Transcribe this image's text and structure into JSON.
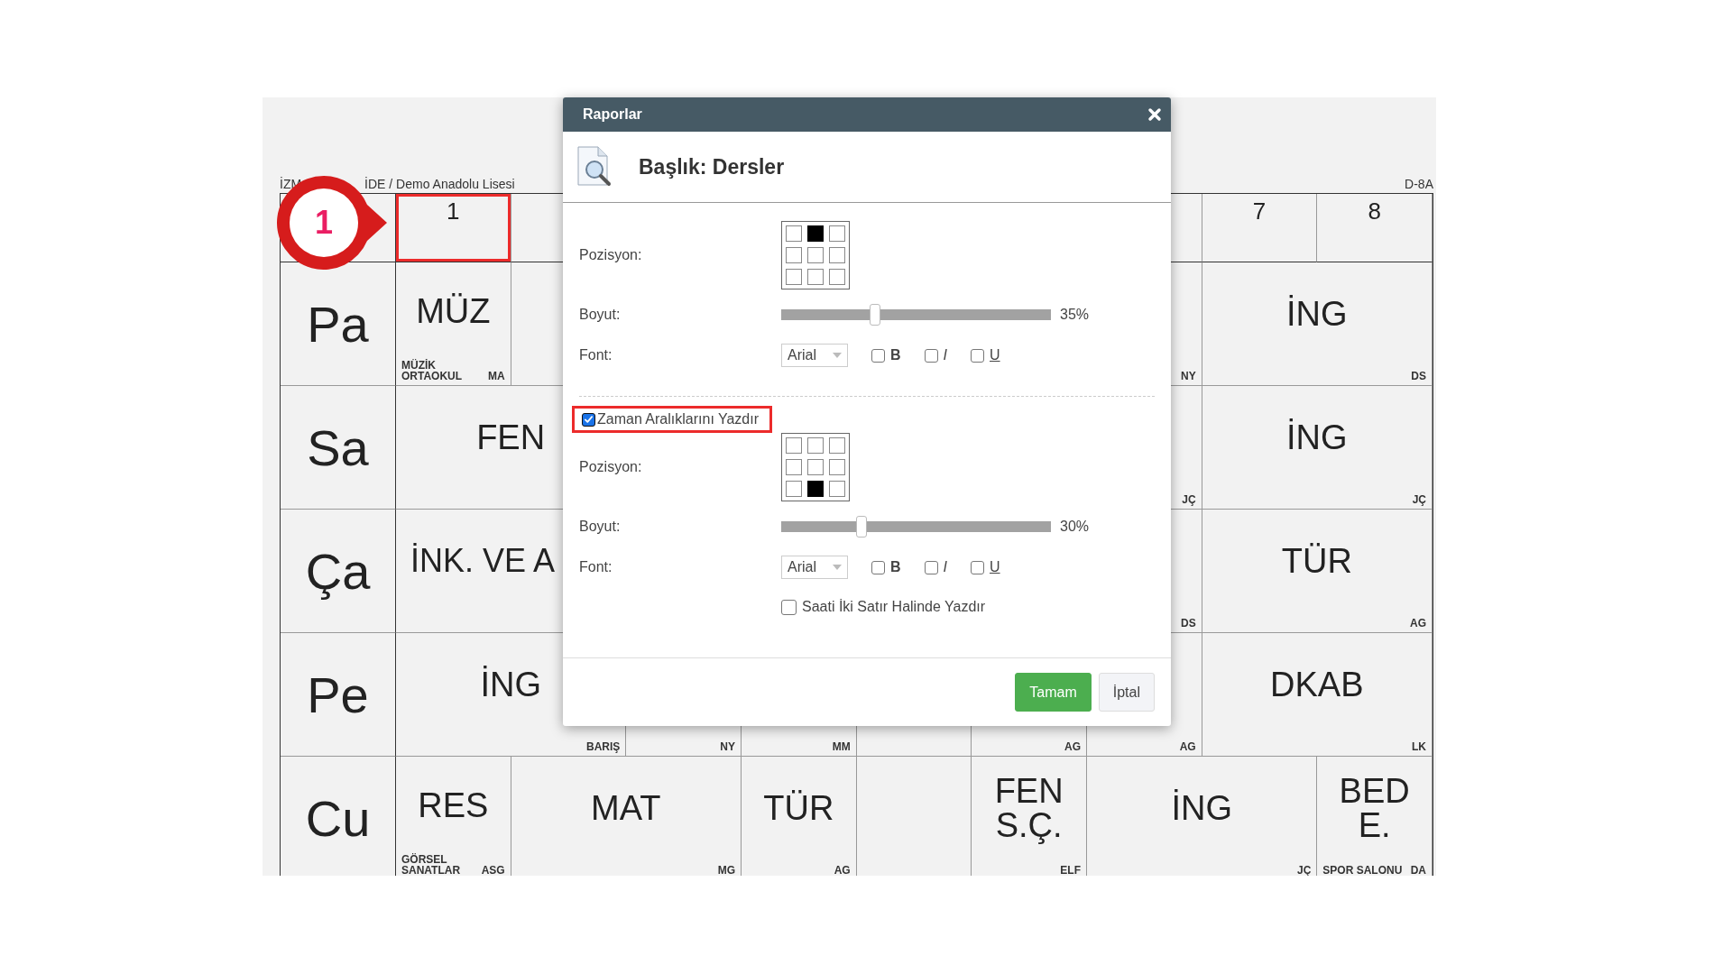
{
  "background": {
    "school_start": "İZM",
    "school_end": "İDE / Demo Anadolu Lisesi",
    "class_code": "D-8A",
    "callout": "1",
    "header": [
      {
        "kind": "cell",
        "label": "1",
        "highlighted": true
      },
      {
        "kind": "cell",
        "highlighted": false
      },
      {
        "kind": "blank"
      },
      {
        "kind": "blank"
      },
      {
        "kind": "blank"
      },
      {
        "kind": "blank"
      },
      {
        "kind": "cell",
        "highlighted": false
      },
      {
        "kind": "cell",
        "label": "7",
        "highlighted": false
      },
      {
        "kind": "cell",
        "label": "8",
        "highlighted": false
      }
    ],
    "rows": [
      {
        "day": "Pa",
        "cells": [
          {
            "kind": "normal",
            "lesson": "MÜZ",
            "room": "MÜZİK ORTAOKUL",
            "teacher": "MA"
          },
          {
            "kind": "normal"
          },
          {
            "kind": "hidden"
          },
          {
            "kind": "hidden"
          },
          {
            "kind": "hidden"
          },
          {
            "kind": "hidden"
          },
          {
            "kind": "normal",
            "teacher": "NY"
          },
          {
            "kind": "normal",
            "colspan": 2,
            "lesson": "İNG",
            "teacher": "DS"
          }
        ]
      },
      {
        "day": "Sa",
        "cells": [
          {
            "kind": "normal",
            "colspan": 2,
            "lesson": "FEN"
          },
          {
            "kind": "hidden"
          },
          {
            "kind": "hidden"
          },
          {
            "kind": "hidden"
          },
          {
            "kind": "hidden"
          },
          {
            "kind": "normal",
            "teacher": "JÇ"
          },
          {
            "kind": "normal",
            "colspan": 2,
            "lesson": "İNG",
            "teacher": "JÇ"
          }
        ]
      },
      {
        "day": "Ça",
        "cells": [
          {
            "kind": "clipped",
            "colspan": 2,
            "lesson": "İNK. VE A"
          },
          {
            "kind": "hidden"
          },
          {
            "kind": "hidden"
          },
          {
            "kind": "hidden"
          },
          {
            "kind": "hidden"
          },
          {
            "kind": "normal",
            "teacher": "DS"
          },
          {
            "kind": "normal",
            "colspan": 2,
            "lesson": "TÜR",
            "teacher": "AG"
          }
        ]
      },
      {
        "day": "Pe",
        "cells": [
          {
            "kind": "normal",
            "colspan": 2,
            "lesson": "İNG",
            "teacher": "BARIŞ"
          },
          {
            "kind": "normal",
            "teacher": "NY"
          },
          {
            "kind": "normal",
            "teacher": "MM"
          },
          {
            "kind": "normal"
          },
          {
            "kind": "normal",
            "teacher": "AG"
          },
          {
            "kind": "normal",
            "teacher": "AG"
          },
          {
            "kind": "normal",
            "colspan": 2,
            "lesson": "DKAB",
            "teacher": "LK"
          }
        ]
      },
      {
        "day": "Cu",
        "cells": [
          {
            "kind": "normal",
            "lesson": "RES",
            "room": "GÖRSEL SANATLAR",
            "teacher": "ASG"
          },
          {
            "kind": "normal",
            "colspan": 2,
            "lesson": "MAT",
            "teacher": "MG"
          },
          {
            "kind": "normal",
            "lesson": "TÜR",
            "teacher": "AG"
          },
          {
            "kind": "normal"
          },
          {
            "kind": "normal",
            "lesson": "FEN S.Ç.",
            "teacher": "ELF"
          },
          {
            "kind": "normal",
            "colspan": 2,
            "lesson": "İNG",
            "teacher": "JÇ"
          },
          {
            "kind": "normal",
            "lesson": "BED E.",
            "room": "SPOR SALONU",
            "teacher": "DA"
          }
        ]
      }
    ]
  },
  "dialog": {
    "title": "Raporlar",
    "heading": "Başlık: Dersler",
    "title_section": {
      "position_label": "Pozisyon:",
      "position": [
        {
          "selected": false
        },
        {
          "selected": true
        },
        {
          "selected": false
        },
        {
          "selected": false
        },
        {
          "selected": false
        },
        {
          "selected": false
        },
        {
          "selected": false
        },
        {
          "selected": false
        },
        {
          "selected": false
        }
      ],
      "size_label": "Boyut:",
      "level": 0.35,
      "size_value": "35%",
      "font_label": "Font:",
      "font": "Arial",
      "styles": [
        {
          "label": "B",
          "kind": "bold",
          "checked": false
        },
        {
          "label": "I",
          "kind": "italic",
          "checked": false
        },
        {
          "label": "U",
          "kind": "underline",
          "checked": false
        }
      ]
    },
    "intervals": {
      "label": "Zaman Aralıklarını Yazdır",
      "checked": true,
      "highlighted": true,
      "position_label": "Pozisyon:",
      "position": [
        {
          "selected": false
        },
        {
          "selected": false
        },
        {
          "selected": false
        },
        {
          "selected": false
        },
        {
          "selected": false
        },
        {
          "selected": false
        },
        {
          "selected": false
        },
        {
          "selected": true
        },
        {
          "selected": false
        }
      ],
      "size_label": "Boyut:",
      "level": 0.3,
      "size_value": "30%",
      "font_label": "Font:",
      "font": "Arial",
      "styles": [
        {
          "label": "B",
          "kind": "bold",
          "checked": false
        },
        {
          "label": "I",
          "kind": "italic",
          "checked": false
        },
        {
          "label": "U",
          "kind": "underline",
          "checked": false
        }
      ],
      "two_line": {
        "label": "Saati İki Satır Halinde Yazdır",
        "checked": false
      }
    },
    "buttons": [
      {
        "label": "Tamam",
        "kind": "primary"
      },
      {
        "label": "İptal",
        "kind": "secondary"
      }
    ]
  }
}
